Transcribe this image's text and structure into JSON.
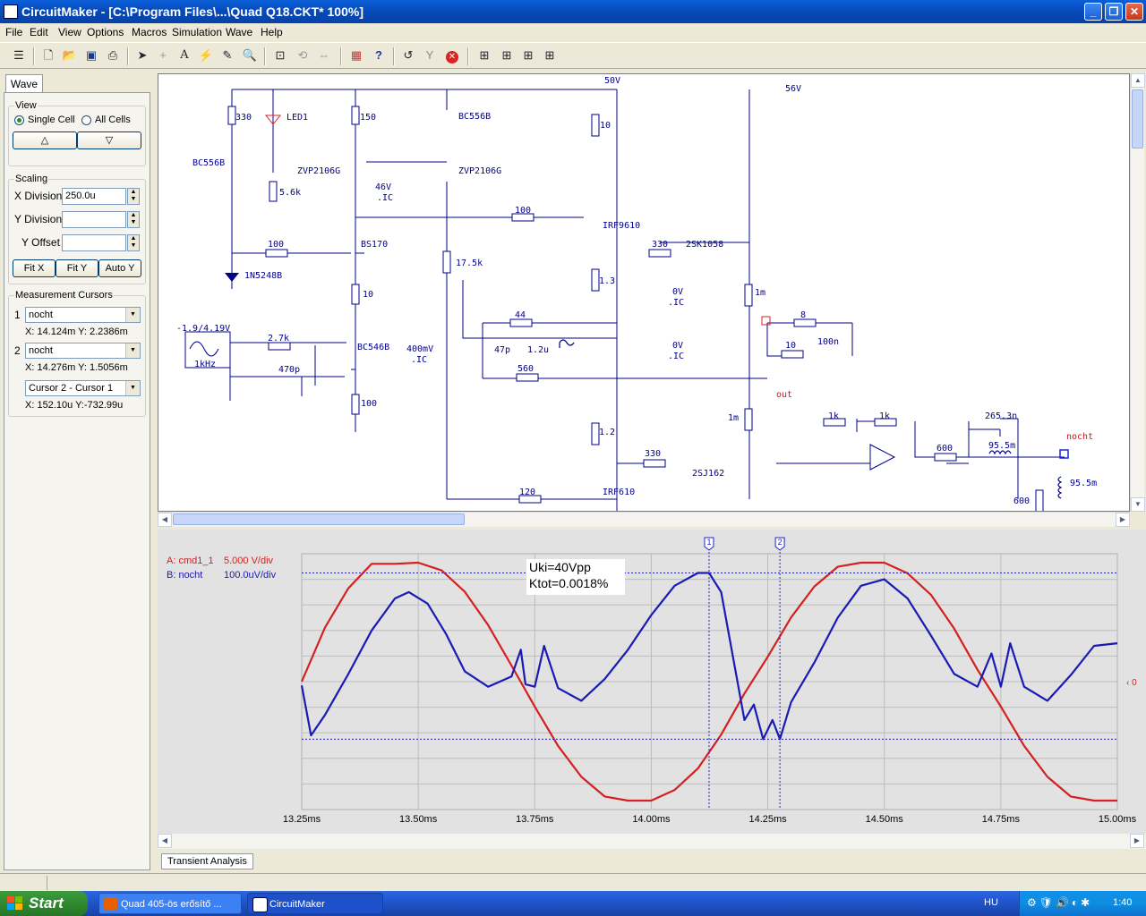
{
  "window": {
    "title": "CircuitMaker - [C:\\Program Files\\...\\Quad Q18.CKT* 100%]"
  },
  "menu": [
    "File",
    "Edit",
    "View",
    "Options",
    "Macros",
    "Simulation",
    "Wave",
    "Help"
  ],
  "left_panel": {
    "tab": "Wave",
    "view": {
      "label": "View",
      "single_cell": "Single Cell",
      "all_cells": "All Cells"
    },
    "scaling": {
      "label": "Scaling",
      "x_division_label": "X Division",
      "x_division_value": "250.0u",
      "y_division_label": "Y Division",
      "y_offset_label": "Y Offset",
      "fit_x": "Fit X",
      "fit_y": "Fit Y",
      "auto_y": "Auto Y"
    },
    "cursors": {
      "label": "Measurement Cursors",
      "c1": {
        "num": "1",
        "signal": "nocht",
        "readout": "X: 14.124m  Y: 2.2386m"
      },
      "c2": {
        "num": "2",
        "signal": "nocht",
        "readout": "X: 14.276m  Y: 1.5056m"
      },
      "diff": {
        "mode": "Cursor 2 - Cursor 1",
        "readout": "X: 152.10u  Y:-732.99u"
      }
    }
  },
  "schematic": {
    "labels": {
      "v50": "50V",
      "v56": "56V",
      "r330": "330",
      "led": "LED1",
      "r150": "150",
      "bc556b_a": "BC556B",
      "bc556b_b": "BC556B",
      "r10_top": "10",
      "zvp_a": "ZVP2106G",
      "zvp_b": "ZVP2106G",
      "r5k6": "5.6k",
      "v46": "46V",
      "ic": ".IC",
      "r100_a": "100",
      "irf9610": "IRF9610",
      "r100_b": "100",
      "bs170": "BS170",
      "r330_b": "330",
      "sk1058": "2SK1058",
      "r17k5": "17.5k",
      "z1n5248": "1N5248B",
      "r1_3": "1.3",
      "r10_mid": "10",
      "v0_a": "0V",
      "r1m_a": "1m",
      "r44": "44",
      "r8": "8",
      "src": "-1.9/4.19V",
      "freq": "1kHz",
      "r2k7": "2.7k",
      "bc546b": "BC546B",
      "v400m": "400mV",
      "c47p": "47p",
      "l1_2u": "1.2u",
      "r10_b": "10",
      "c100n": "100n",
      "c470p": "470p",
      "v0_b": "0V",
      "r560": "560",
      "out": "out",
      "r100_c": "100",
      "r1m_b": "1m",
      "r1k_a": "1k",
      "r1k_b": "1k",
      "c265": "265.3n",
      "r1_2": "1.2",
      "nocht": "nocht",
      "r600_a": "600",
      "l95_a": "95.5m",
      "r330_c": "330",
      "sj162": "2SJ162",
      "r120": "120",
      "irf610": "IRF610",
      "r600_b": "600",
      "l95_b": "95.5m"
    }
  },
  "wave": {
    "legend_a": "A: cmd1_1",
    "legend_a_scale": "5.000 V/div",
    "legend_b": "B: nocht",
    "legend_b_scale": "100.0uV/div",
    "note_line1": "Uki=40Vpp",
    "note_line2": "Ktot=0.0018%",
    "cursor1": "1",
    "cursor2": "2",
    "zero_marker": "0",
    "colors": {
      "a": "#d42020",
      "b": "#1a1ab4",
      "cursor": "#2424c8"
    },
    "tab": "Transient Analysis"
  },
  "chart_data": {
    "type": "line",
    "xlabel": "",
    "ylabel": "",
    "xlim": [
      13.25,
      15.0
    ],
    "x_ticks": [
      "13.25ms",
      "13.50ms",
      "13.75ms",
      "14.00ms",
      "14.25ms",
      "14.50ms",
      "14.75ms",
      "15.00ms"
    ],
    "cursors_x_ms": [
      14.124,
      14.276
    ],
    "series": [
      {
        "name": "A: cmd1_1",
        "scale": "5.000 V/div",
        "x": [
          13.25,
          13.3,
          13.35,
          13.4,
          13.45,
          13.5,
          13.55,
          13.6,
          13.65,
          13.7,
          13.75,
          13.8,
          13.85,
          13.9,
          13.95,
          14.0,
          14.05,
          14.1,
          14.15,
          14.2,
          14.25,
          14.3,
          14.35,
          14.4,
          14.45,
          14.5,
          14.55,
          14.6,
          14.65,
          14.7,
          14.75,
          14.8,
          14.85,
          14.9,
          14.95,
          15.0
        ],
        "y": [
          0.0,
          9.1,
          15.7,
          19.8,
          19.8,
          20.0,
          18.7,
          15.1,
          9.5,
          2.7,
          -4.2,
          -10.8,
          -16.0,
          -19.3,
          -20.0,
          -20.0,
          -18.2,
          -14.6,
          -8.9,
          -2.0,
          4.2,
          10.8,
          16.0,
          19.3,
          20.0,
          20.0,
          18.2,
          14.6,
          8.9,
          2.0,
          -4.2,
          -10.8,
          -16.0,
          -19.3,
          -20.0,
          -20.0
        ]
      },
      {
        "name": "B: nocht",
        "scale": "100.0uV/div",
        "x": [
          13.25,
          13.27,
          13.3,
          13.35,
          13.4,
          13.45,
          13.48,
          13.52,
          13.56,
          13.6,
          13.65,
          13.7,
          13.72,
          13.73,
          13.75,
          13.77,
          13.8,
          13.85,
          13.9,
          13.95,
          14.0,
          14.05,
          14.1,
          14.124,
          14.15,
          14.2,
          14.22,
          14.24,
          14.26,
          14.276,
          14.3,
          14.35,
          14.4,
          14.45,
          14.5,
          14.55,
          14.6,
          14.65,
          14.7,
          14.73,
          14.75,
          14.77,
          14.8,
          14.85,
          14.9,
          14.95,
          15.0
        ],
        "y": [
          -3,
          -42,
          -26,
          6,
          40,
          65,
          70,
          61,
          37,
          8,
          -4,
          4,
          25,
          -2,
          -4,
          28,
          -5,
          -15,
          2,
          25,
          52,
          75,
          85,
          85,
          70,
          -30,
          -18,
          -45,
          -30,
          -45,
          -16,
          15,
          50,
          75,
          80,
          65,
          36,
          6,
          -4,
          22,
          -4,
          30,
          -4,
          -15,
          5,
          28,
          30
        ]
      }
    ]
  }
}
